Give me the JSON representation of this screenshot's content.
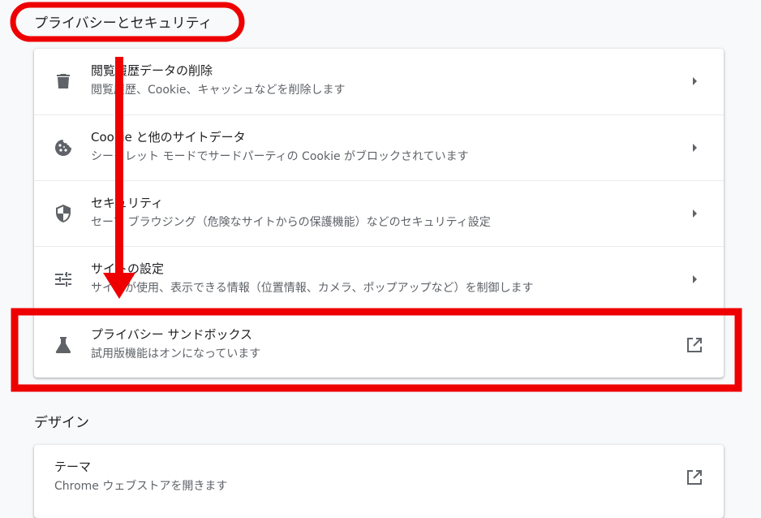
{
  "sections": {
    "privacy_title": "プライバシーとセキュリティ",
    "design_title": "デザイン"
  },
  "privacy_items": [
    {
      "title": "閲覧履歴データの削除",
      "subtitle": "閲覧履歴、Cookie、キャッシュなどを削除します",
      "icon": "trash-icon",
      "action": "arrow-right-icon"
    },
    {
      "title": "Cookie と他のサイトデータ",
      "subtitle": "シークレット モードでサードパーティの Cookie がブロックされています",
      "icon": "cookie-icon",
      "action": "arrow-right-icon"
    },
    {
      "title": "セキュリティ",
      "subtitle": "セーフ ブラウジング（危険なサイトからの保護機能）などのセキュリティ設定",
      "icon": "shield-icon",
      "action": "arrow-right-icon"
    },
    {
      "title": "サイトの設定",
      "subtitle": "サイトが使用、表示できる情報（位置情報、カメラ、ポップアップなど）を制御します",
      "icon": "tune-icon",
      "action": "arrow-right-icon"
    },
    {
      "title": "プライバシー サンドボックス",
      "subtitle": "試用版機能はオンになっています",
      "icon": "flask-icon",
      "action": "open-in-new-icon"
    }
  ],
  "design_items": [
    {
      "title": "テーマ",
      "subtitle": "Chrome ウェブストアを開きます",
      "action": "open-in-new-icon"
    }
  ],
  "colors": {
    "annotation_red": "#ee0000",
    "icon_gray": "#5f6368",
    "background": "#f8f9fa"
  }
}
